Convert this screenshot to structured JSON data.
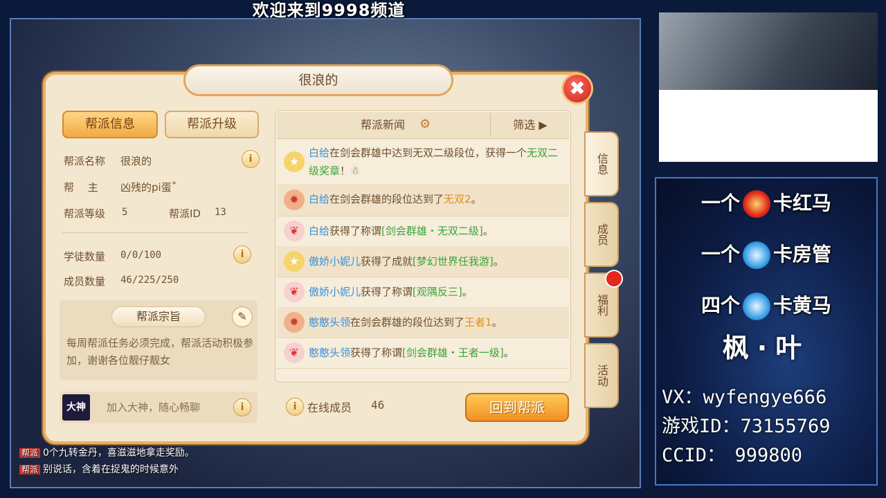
{
  "stream": {
    "banner": "欢迎来到9998频道"
  },
  "panel": {
    "title": "很浪的",
    "close_label": "✖",
    "tabs": [
      {
        "label": "帮派信息",
        "active": true
      },
      {
        "label": "帮派升级",
        "active": false
      }
    ],
    "info": {
      "name_label": "帮派名称",
      "name_value": "很浪的",
      "leader_label": "帮　 主",
      "leader_value": "凶残的pi蛋˚",
      "level_label": "帮派等级",
      "level_value": "5",
      "id_label": "帮派ID",
      "id_value": "13",
      "apprentice_label": "学徒数量",
      "apprentice_value": "0/0/100",
      "members_label": "成员数量",
      "members_value": "46/225/250"
    },
    "motto": {
      "title": "帮派宗旨",
      "text": "每周帮派任务必须完成，帮派活动积极参加，谢谢各位靓仔靓女"
    },
    "dashen": {
      "logo": "大神",
      "text": "加入大神，随心畅聊"
    },
    "news": {
      "header": "帮派新闻",
      "filter": "筛选 ▶",
      "items": [
        {
          "icon": "star",
          "name": "白给",
          "pre": "在剑会群雄中达到无双二级段位，获得一个",
          "highlight": "无双二级奖章",
          "post": "！☃"
        },
        {
          "icon": "badge",
          "name": "白给",
          "pre": "在剑会群雄的段位达到了",
          "highlight": "无双2",
          "post": "。"
        },
        {
          "icon": "wing",
          "name": "白给",
          "pre": "获得了称谓",
          "highlight": "[剑会群雄・无双二级]",
          "post": "。"
        },
        {
          "icon": "star",
          "name": "傲娇小妮儿",
          "pre": "获得了成就",
          "highlight": "[梦幻世界任我游]",
          "post": "。"
        },
        {
          "icon": "wing",
          "name": "傲娇小妮儿",
          "pre": "获得了称谓",
          "highlight": "[观隅反三]",
          "post": "。"
        },
        {
          "icon": "badge",
          "name": "憨憨头领",
          "pre": "在剑会群雄的段位达到了",
          "highlight": "王者1",
          "post": "。"
        },
        {
          "icon": "wing",
          "name": "憨憨头领",
          "pre": "获得了称谓",
          "highlight": "[剑会群雄・王者一级]",
          "post": "。"
        }
      ]
    },
    "online_label": "在线成员",
    "online_count": "46",
    "return_label": "回到帮派",
    "side_tabs": [
      {
        "label": "信息",
        "active": true
      },
      {
        "label": "成员",
        "active": false
      },
      {
        "label": "福利",
        "active": false
      },
      {
        "label": "活动",
        "active": false
      }
    ]
  },
  "promo": {
    "lines": [
      {
        "pre": "一个",
        "post": "卡红马",
        "orb": "red"
      },
      {
        "pre": "一个",
        "post": "卡房管",
        "orb": "blue"
      },
      {
        "pre": "四个",
        "post": "卡黄马",
        "orb": "blue"
      }
    ],
    "name": "枫·叶",
    "contacts": [
      "VX：wyfengye666",
      "游戏ID：73155769",
      "CCID：　999800"
    ]
  },
  "chat": [
    {
      "tag": "帮派",
      "text": "0个九转金丹，喜滋滋地拿走奖励。"
    },
    {
      "tag": "帮派",
      "text": "别说话，含着在捉鬼的时候意外"
    }
  ],
  "colors": {
    "accent": "#f0a83e",
    "name_blue": "#3a8ed8",
    "green": "#3ca33a",
    "orange": "#e0901a",
    "close_red": "#c8241c"
  }
}
